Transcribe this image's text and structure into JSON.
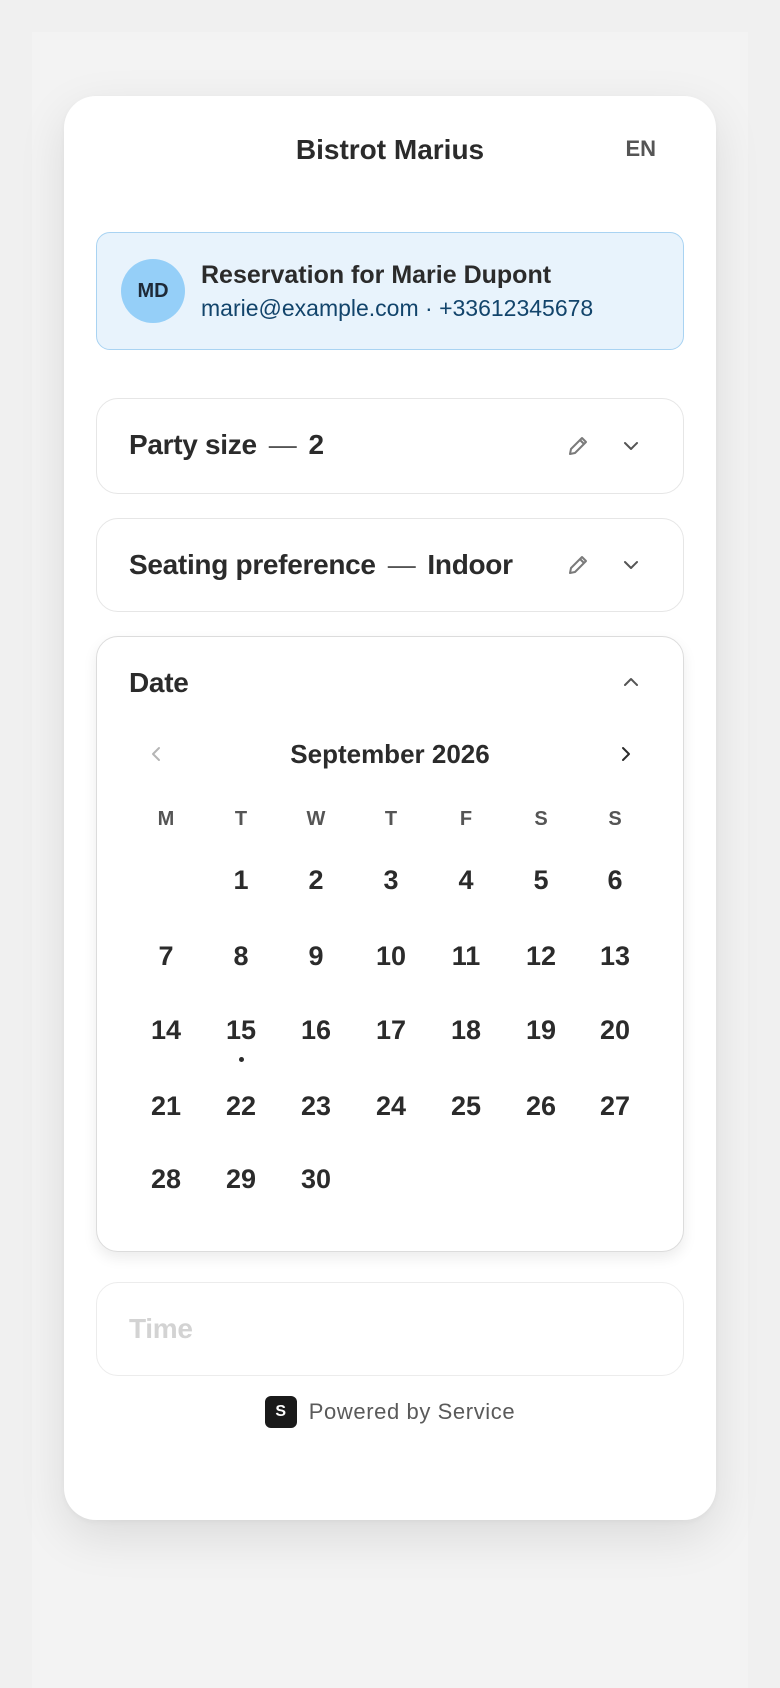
{
  "header": {
    "title": "Bistrot Marius",
    "language": "EN"
  },
  "reservation": {
    "initials": "MD",
    "title": "Reservation for Marie Dupont",
    "contact": "marie@example.com · +33612345678"
  },
  "party_size": {
    "label": "Party size",
    "separator": "—",
    "value": "2",
    "edit_icon": "pencil-icon",
    "expand_icon": "chevron-down-icon"
  },
  "seating": {
    "label": "Seating preference",
    "separator": "—",
    "value": "Indoor",
    "edit_icon": "pencil-icon",
    "expand_icon": "chevron-down-icon"
  },
  "date": {
    "label": "Date",
    "collapse_icon": "chevron-up-icon",
    "month": "September 2026",
    "prev_icon": "chevron-left-icon",
    "next_icon": "chevron-right-icon",
    "weekdays": [
      "M",
      "T",
      "W",
      "T",
      "F",
      "S",
      "S"
    ],
    "days": [
      [
        "",
        "1",
        "2",
        "3",
        "4",
        "5",
        "6"
      ],
      [
        "7",
        "8",
        "9",
        "10",
        "11",
        "12",
        "13"
      ],
      [
        "14",
        "15",
        "16",
        "17",
        "18",
        "19",
        "20"
      ],
      [
        "21",
        "22",
        "23",
        "24",
        "25",
        "26",
        "27"
      ],
      [
        "28",
        "29",
        "30",
        "",
        "",
        "",
        ""
      ]
    ],
    "today": "15"
  },
  "time": {
    "label": "Time"
  },
  "footer": {
    "logo_letter": "S",
    "text": "Powered by Service"
  },
  "colors": {
    "banner_bg": "#e8f3fc",
    "banner_border": "#a9d3f2",
    "avatar_bg": "#95cff8",
    "contact_text": "#12446b",
    "disabled_text": "#d3d3d3"
  }
}
